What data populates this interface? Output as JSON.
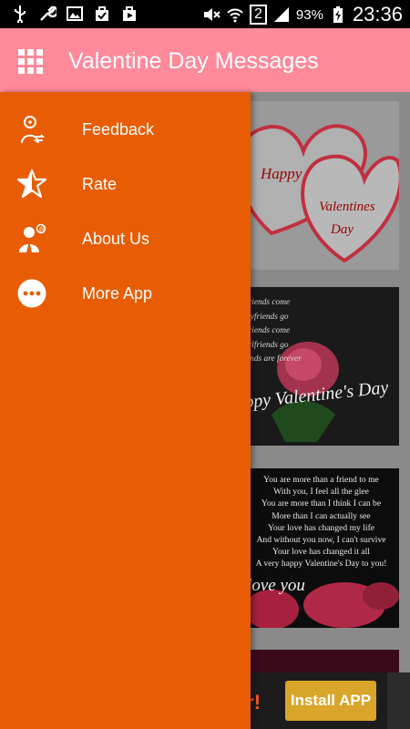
{
  "status_bar": {
    "sim_slot": "2",
    "battery": "93%",
    "time": "23:36"
  },
  "app_bar": {
    "title": "Valentine Day Messages",
    "menu_icon": "grid-menu-icon"
  },
  "drawer": {
    "items": [
      {
        "label": "Feedback",
        "icon": "feedback-icon"
      },
      {
        "label": "Rate",
        "icon": "star-icon"
      },
      {
        "label": "About Us",
        "icon": "about-us-icon"
      },
      {
        "label": "More App",
        "icon": "more-dots-icon"
      }
    ]
  },
  "cards": {
    "card1": {
      "happy": "Happy",
      "valentines": "Valentines",
      "day": "Day"
    },
    "card2": {
      "poem": "friends come\noyfriends go\nfriends come\nirlfriends go\nends are forever",
      "script": "appy Valentine's Day"
    },
    "card3": {
      "poem": "You are more than a friend to me\nWith you, I feel all the glee\nYou are more than I think I can be\nMore than I can actually see\nYour love has changed my life\nAnd without you now, I can't survive\nYour love has changed it all\nA very happy Valentine's Day to you!",
      "script": "I love you"
    }
  },
  "ad_banner": {
    "text": "er!",
    "button_label": "Install APP"
  },
  "colors": {
    "app_bar": "#ff8a9a",
    "drawer": "#e85d04",
    "status_bar": "#000000"
  }
}
